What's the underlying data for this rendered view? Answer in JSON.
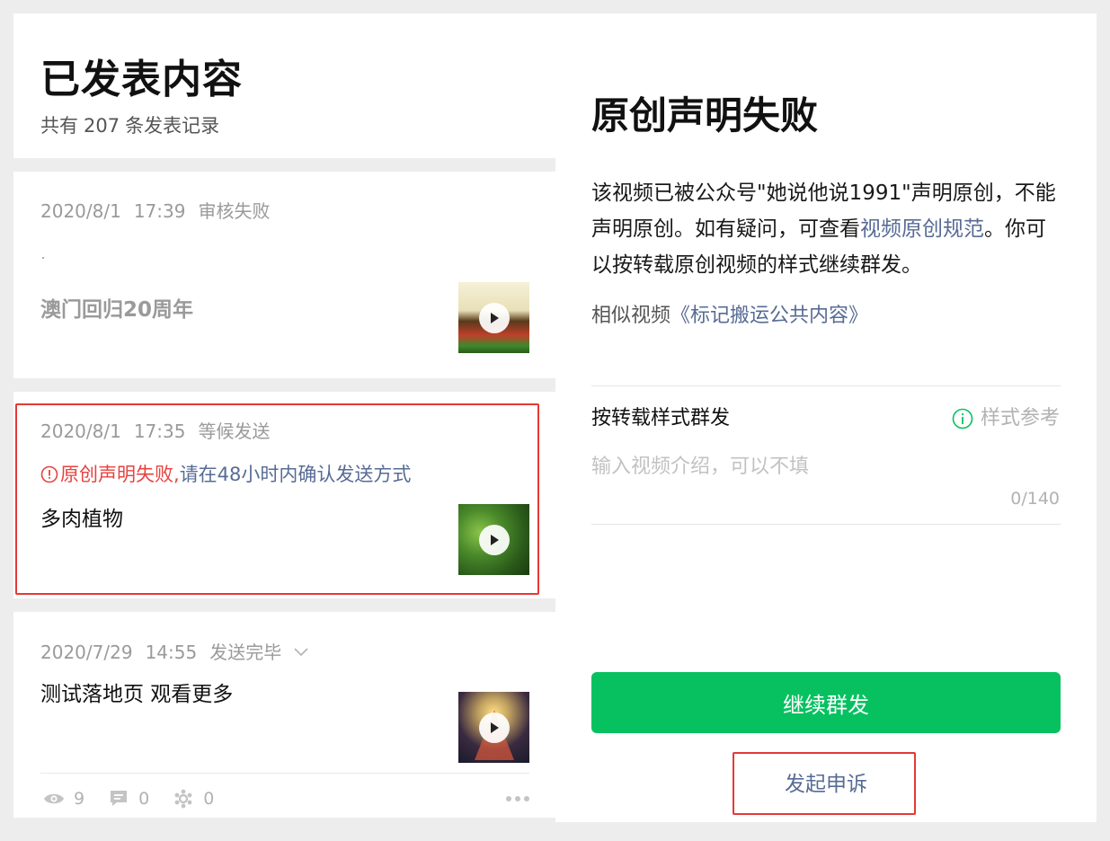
{
  "left": {
    "title": "已发表内容",
    "subtitle_prefix": "共有",
    "subtitle_count": "207",
    "subtitle_suffix": "条发表记录",
    "cards": [
      {
        "date": "2020/8/1",
        "time": "17:39",
        "status": "审核失败",
        "title": "澳门回归20周年"
      },
      {
        "date": "2020/8/1",
        "time": "17:35",
        "status": "等候发送",
        "warning_red": "原创声明失败,",
        "warning_blue": "请在48小时内确认发送方式",
        "title": "多肉植物"
      },
      {
        "date": "2020/7/29",
        "time": "14:55",
        "status": "发送完毕",
        "title": "测试落地页 观看更多",
        "views": "9",
        "comments": "0",
        "shares": "0"
      }
    ]
  },
  "right": {
    "title": "原创声明失败",
    "desc_part1": "该视频已被公众号\"她说他说1991\"声明原创，不能声明原创。如有疑问，可查看",
    "desc_link": "视频原创规范",
    "desc_part2": "。你可以按转载原创视频的样式继续群发。",
    "similar_label": "相似视频",
    "similar_link": "《标记搬运公共内容》",
    "section_label": "按转载样式群发",
    "style_ref": "样式参考",
    "input_placeholder": "输入视频介绍，可以不填",
    "counter": "0/140",
    "continue_button": "继续群发",
    "appeal_button": "发起申诉"
  },
  "colors": {
    "green": "#07c160",
    "link": "#576b95",
    "error": "#e64340",
    "highlight": "#e53935"
  }
}
